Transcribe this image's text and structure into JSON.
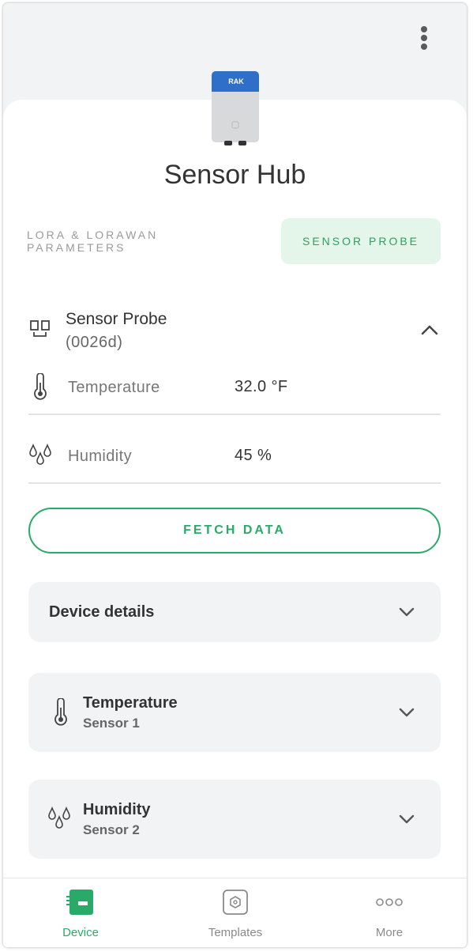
{
  "header": {
    "device_name": "Sensor Hub",
    "device_image": "rak-device-image",
    "device_logo_text": "RAK"
  },
  "tabs": [
    {
      "label": "LORA & LORAWAN PARAMETERS",
      "active": false
    },
    {
      "label": "SENSOR PROBE",
      "active": true
    }
  ],
  "probe": {
    "icon": "probe-ports-icon",
    "name": "Sensor Probe",
    "id": "(0026d)",
    "readings": [
      {
        "icon": "thermometer-icon",
        "label": "Temperature",
        "value": "32.0 °F"
      },
      {
        "icon": "droplets-icon",
        "label": "Humidity",
        "value": "45 %"
      }
    ]
  },
  "fetch_button": {
    "label": "FETCH DATA"
  },
  "cards": [
    {
      "title": "Device details",
      "subtitle": ""
    },
    {
      "icon": "thermometer-icon",
      "title": "Temperature",
      "subtitle": "Sensor 1"
    },
    {
      "icon": "droplets-icon",
      "title": "Humidity",
      "subtitle": "Sensor 2"
    }
  ],
  "bottom_nav": [
    {
      "icon": "device-icon",
      "label": "Device",
      "active": true
    },
    {
      "icon": "templates-icon",
      "label": "Templates",
      "active": false
    },
    {
      "icon": "more-dots-icon",
      "label": "More",
      "active": false
    }
  ],
  "colors": {
    "accent": "#2aaa68",
    "tab_active_bg": "#e3f6e9",
    "card_bg": "#f2f3f5",
    "device_blue": "#2f6fc8"
  }
}
